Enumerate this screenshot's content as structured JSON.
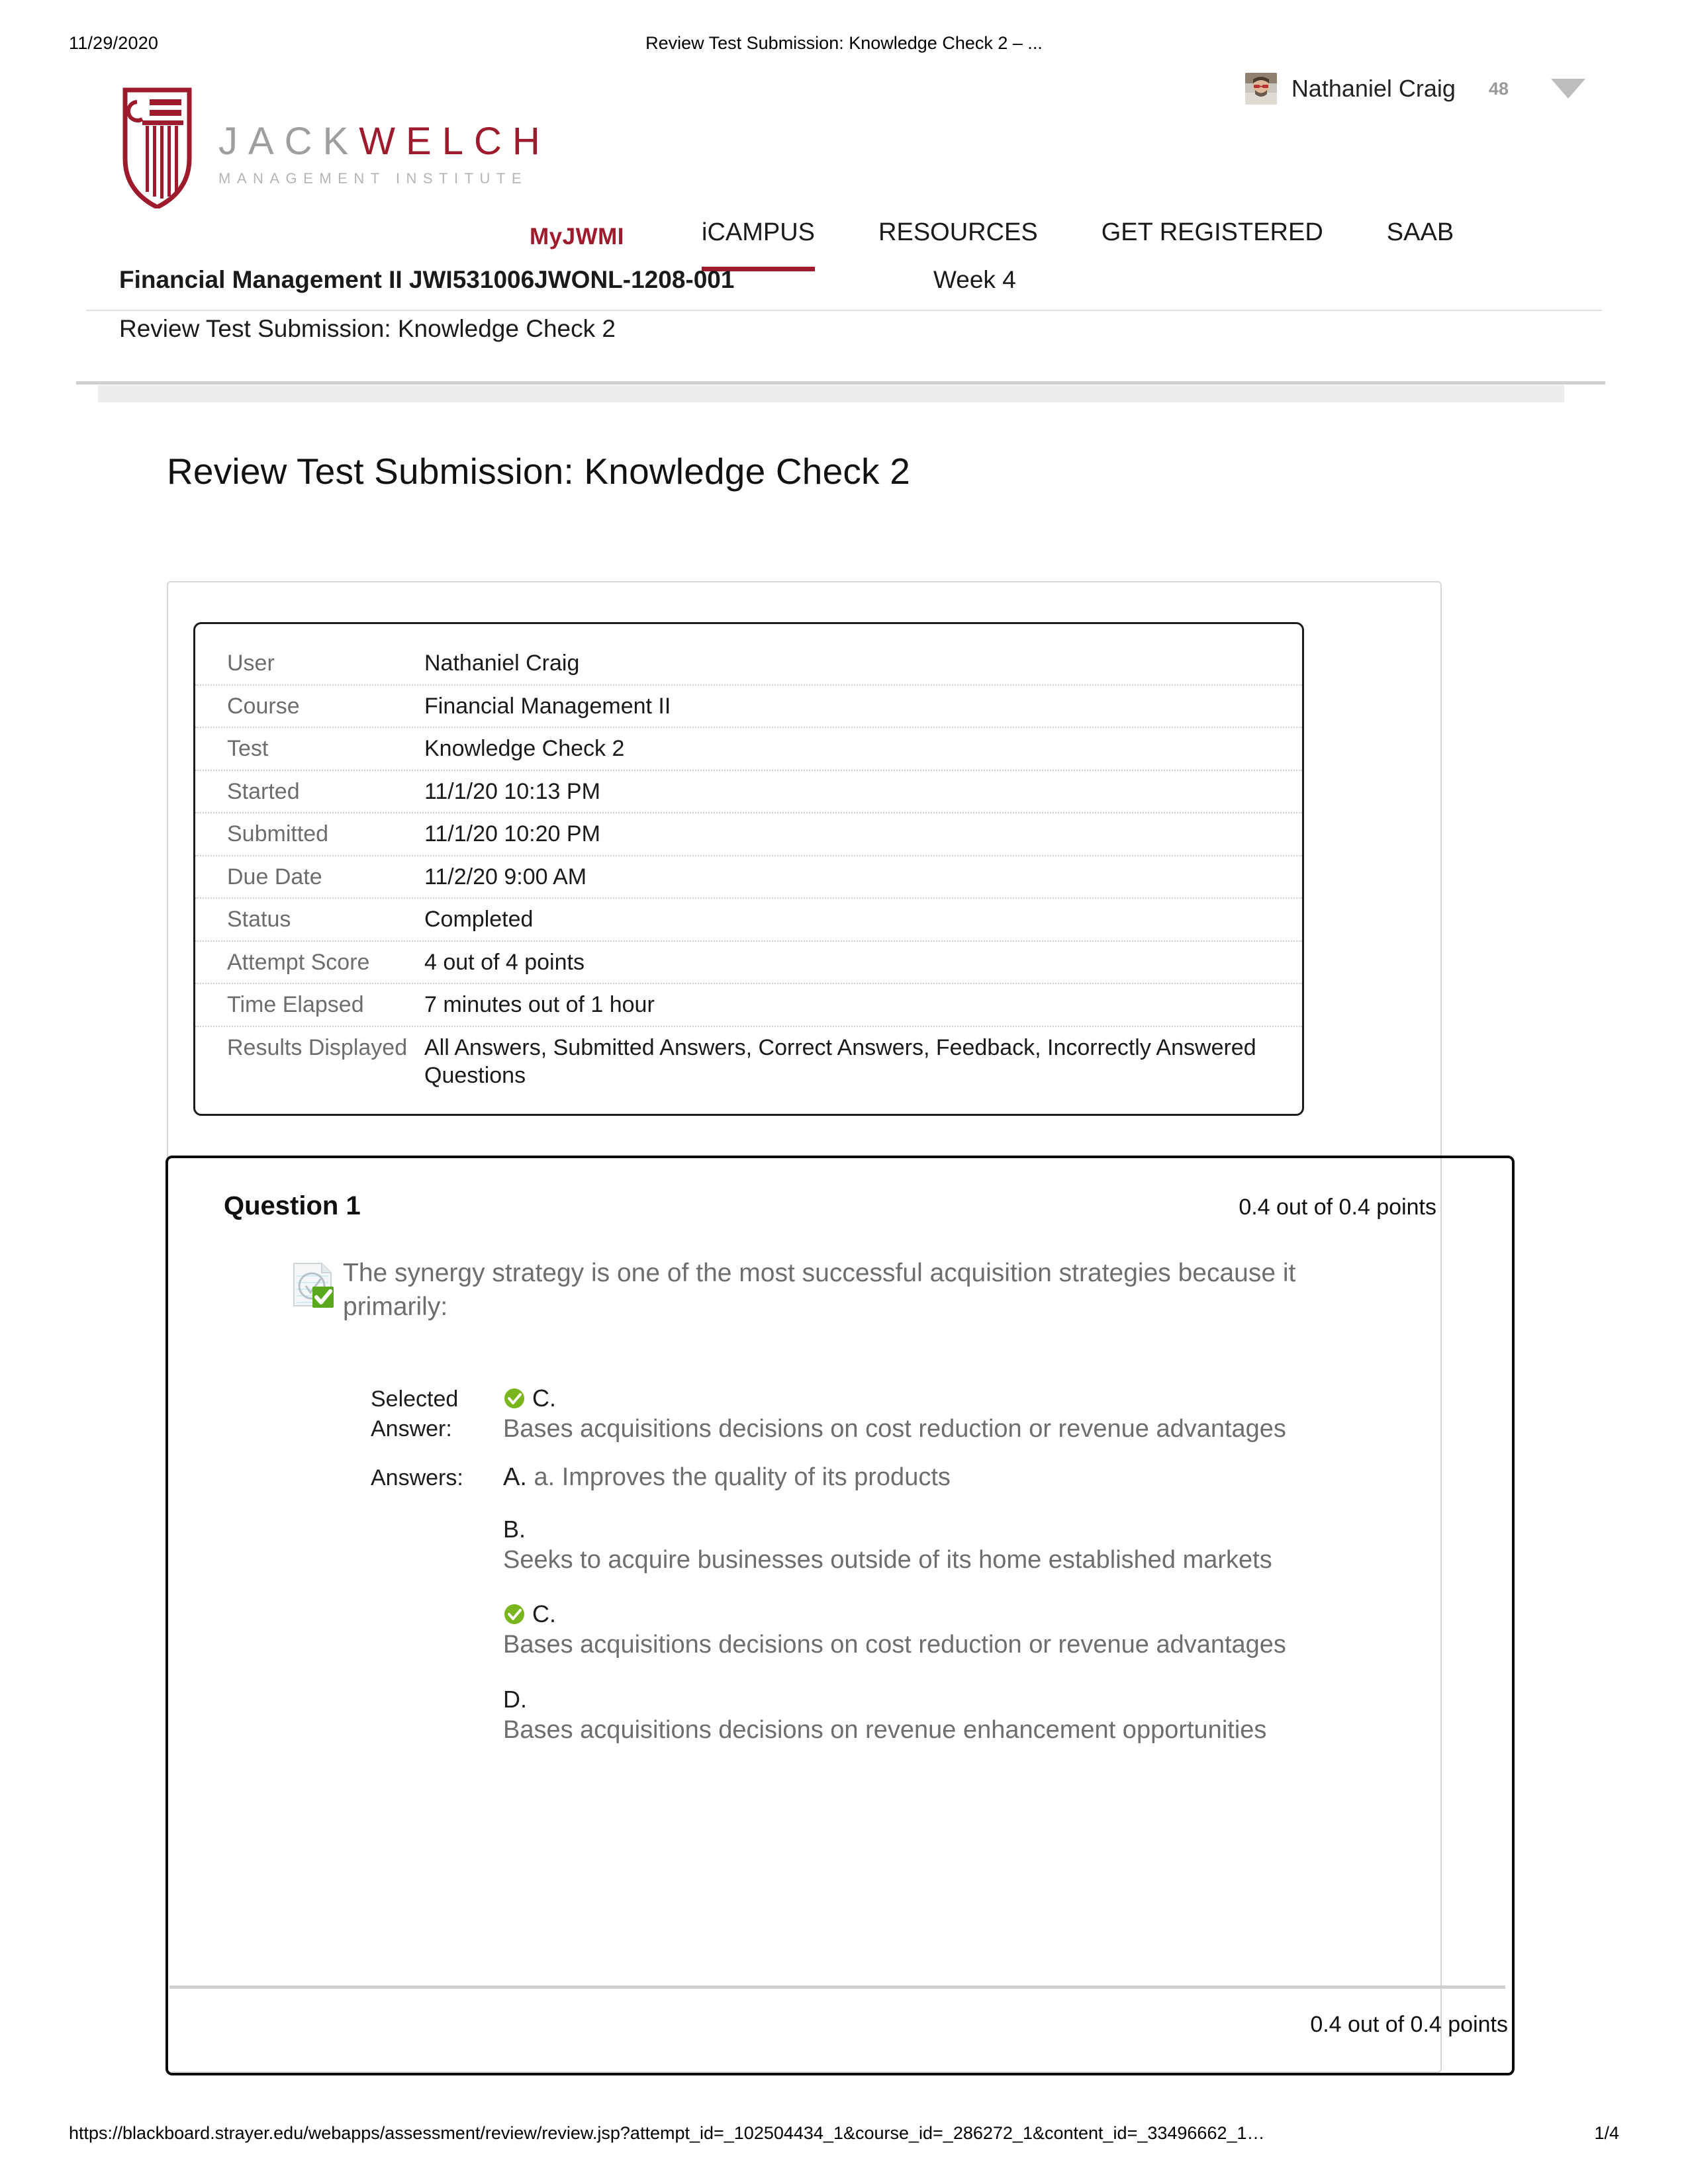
{
  "print": {
    "date": "11/29/2020",
    "title": "Review Test Submission: Knowledge Check 2 – ...",
    "url": "https://blackboard.strayer.edu/webapps/assessment/review/review.jsp?attempt_id=_102504434_1&course_id=_286272_1&content_id=_33496662_1…",
    "page": "1/4"
  },
  "brand": {
    "word_jack": "JACK",
    "word_welch": "WELCH",
    "tagline": "MANAGEMENT INSTITUTE",
    "myjwmi": "MyJWMI",
    "red": "#9d1b2d",
    "gray": "#9e9e9e"
  },
  "user": {
    "name": "Nathaniel Craig",
    "badge_count": "48"
  },
  "nav": {
    "items": [
      {
        "label": "iCAMPUS",
        "active": true
      },
      {
        "label": "RESOURCES",
        "active": false
      },
      {
        "label": "GET REGISTERED",
        "active": false
      },
      {
        "label": "SAAB",
        "active": false
      }
    ]
  },
  "course": {
    "title": "Financial Management II JWI531006JWONL-1208-001",
    "week": "Week 4",
    "breadcrumb": "Review Test Submission: Knowledge Check 2"
  },
  "page_title": "Review Test Submission: Knowledge Check 2",
  "info": {
    "rows": [
      {
        "label": "User",
        "value": "Nathaniel Craig"
      },
      {
        "label": "Course",
        "value": "Financial Management II"
      },
      {
        "label": "Test",
        "value": "Knowledge Check 2"
      },
      {
        "label": "Started",
        "value": "11/1/20 10:13 PM"
      },
      {
        "label": "Submitted",
        "value": "11/1/20 10:20 PM"
      },
      {
        "label": "Due Date",
        "value": "11/2/20 9:00 AM"
      },
      {
        "label": "Status",
        "value": "Completed"
      },
      {
        "label": "Attempt Score",
        "value": "4 out of 4 points"
      },
      {
        "label": "Time Elapsed",
        "value": "7 minutes out of 1 hour"
      },
      {
        "label": "Results Displayed",
        "value": "All Answers, Submitted Answers, Correct Answers, Feedback, Incorrectly Answered Questions"
      }
    ]
  },
  "question": {
    "number": "Question 1",
    "points": "0.4 out of 0.4 points",
    "points_bottom": "0.4 out of 0.4 points",
    "prompt": "The synergy strategy is one of the most successful acquisition strategies because it primarily:",
    "selected_label": "Selected Answer:",
    "selected_letter": "C.",
    "selected_text": "Bases acquisitions decisions on cost reduction or revenue advantages",
    "selected_correct": true,
    "answers_label": "Answers:",
    "options": [
      {
        "letter": "A.",
        "text": "a. Improves the quality of its products",
        "correct": false,
        "inline": true
      },
      {
        "letter": "B.",
        "text": "Seeks to acquire businesses outside of its home established markets",
        "correct": false,
        "inline": false
      },
      {
        "letter": "C.",
        "text": "Bases acquisitions decisions on cost reduction or revenue advantages",
        "correct": true,
        "inline": false
      },
      {
        "letter": "D.",
        "text": "Bases acquisitions decisions on revenue enhancement opportunities",
        "correct": false,
        "inline": false
      }
    ]
  }
}
